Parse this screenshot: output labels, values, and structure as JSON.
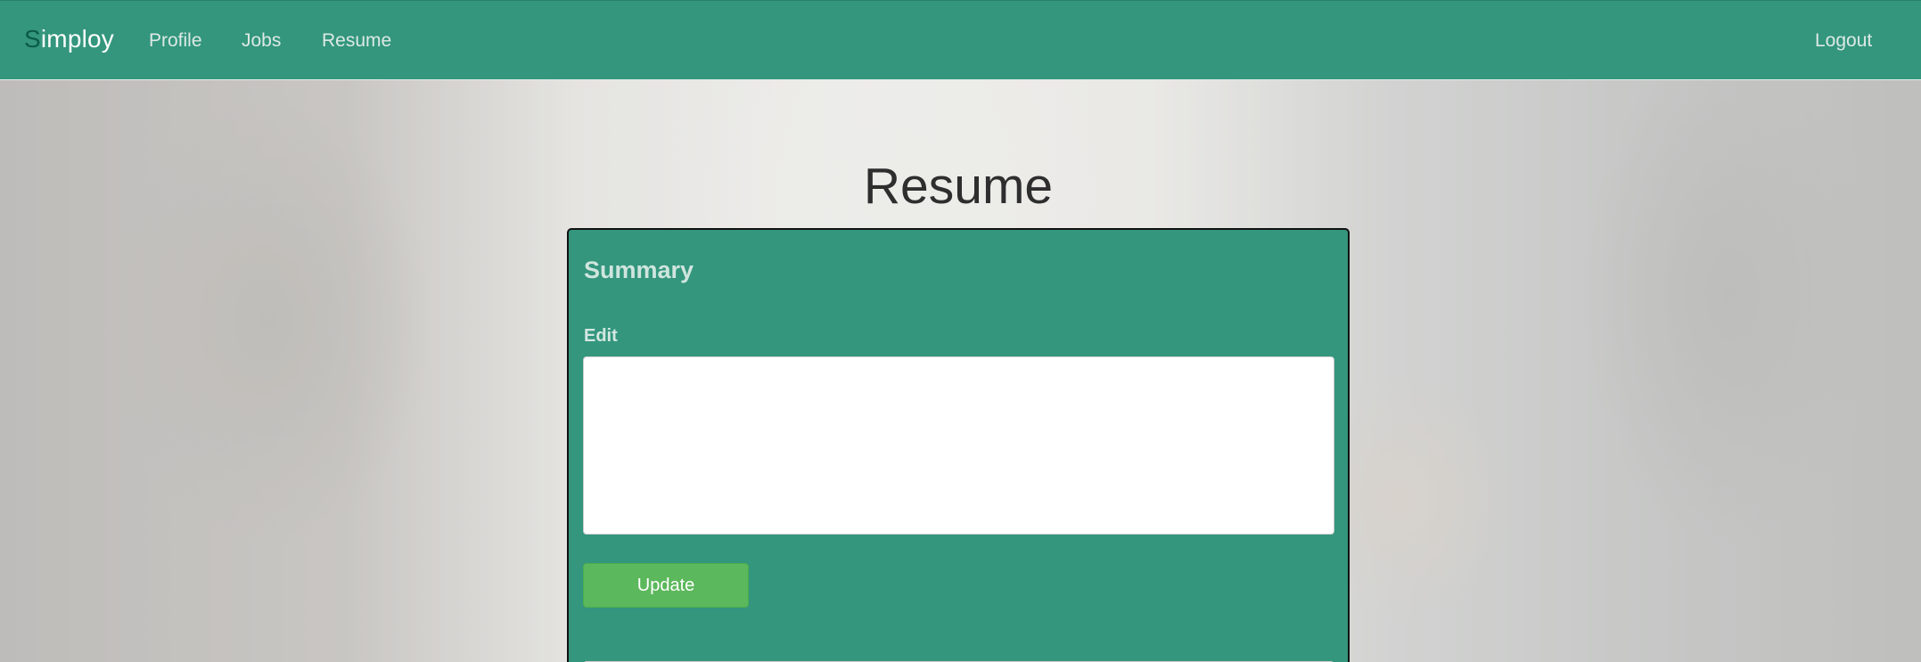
{
  "nav": {
    "brand_first": "S",
    "brand_rest": "imploy",
    "links": [
      "Profile",
      "Jobs",
      "Resume"
    ],
    "logout": "Logout"
  },
  "page": {
    "title": "Resume"
  },
  "summary": {
    "heading": "Summary",
    "edit_label": "Edit",
    "value": "",
    "update_label": "Update"
  },
  "colors": {
    "navbar": "#33967d",
    "panel": "#33967d",
    "brand_accent": "#0b5b46",
    "button": "#5cb85c"
  }
}
